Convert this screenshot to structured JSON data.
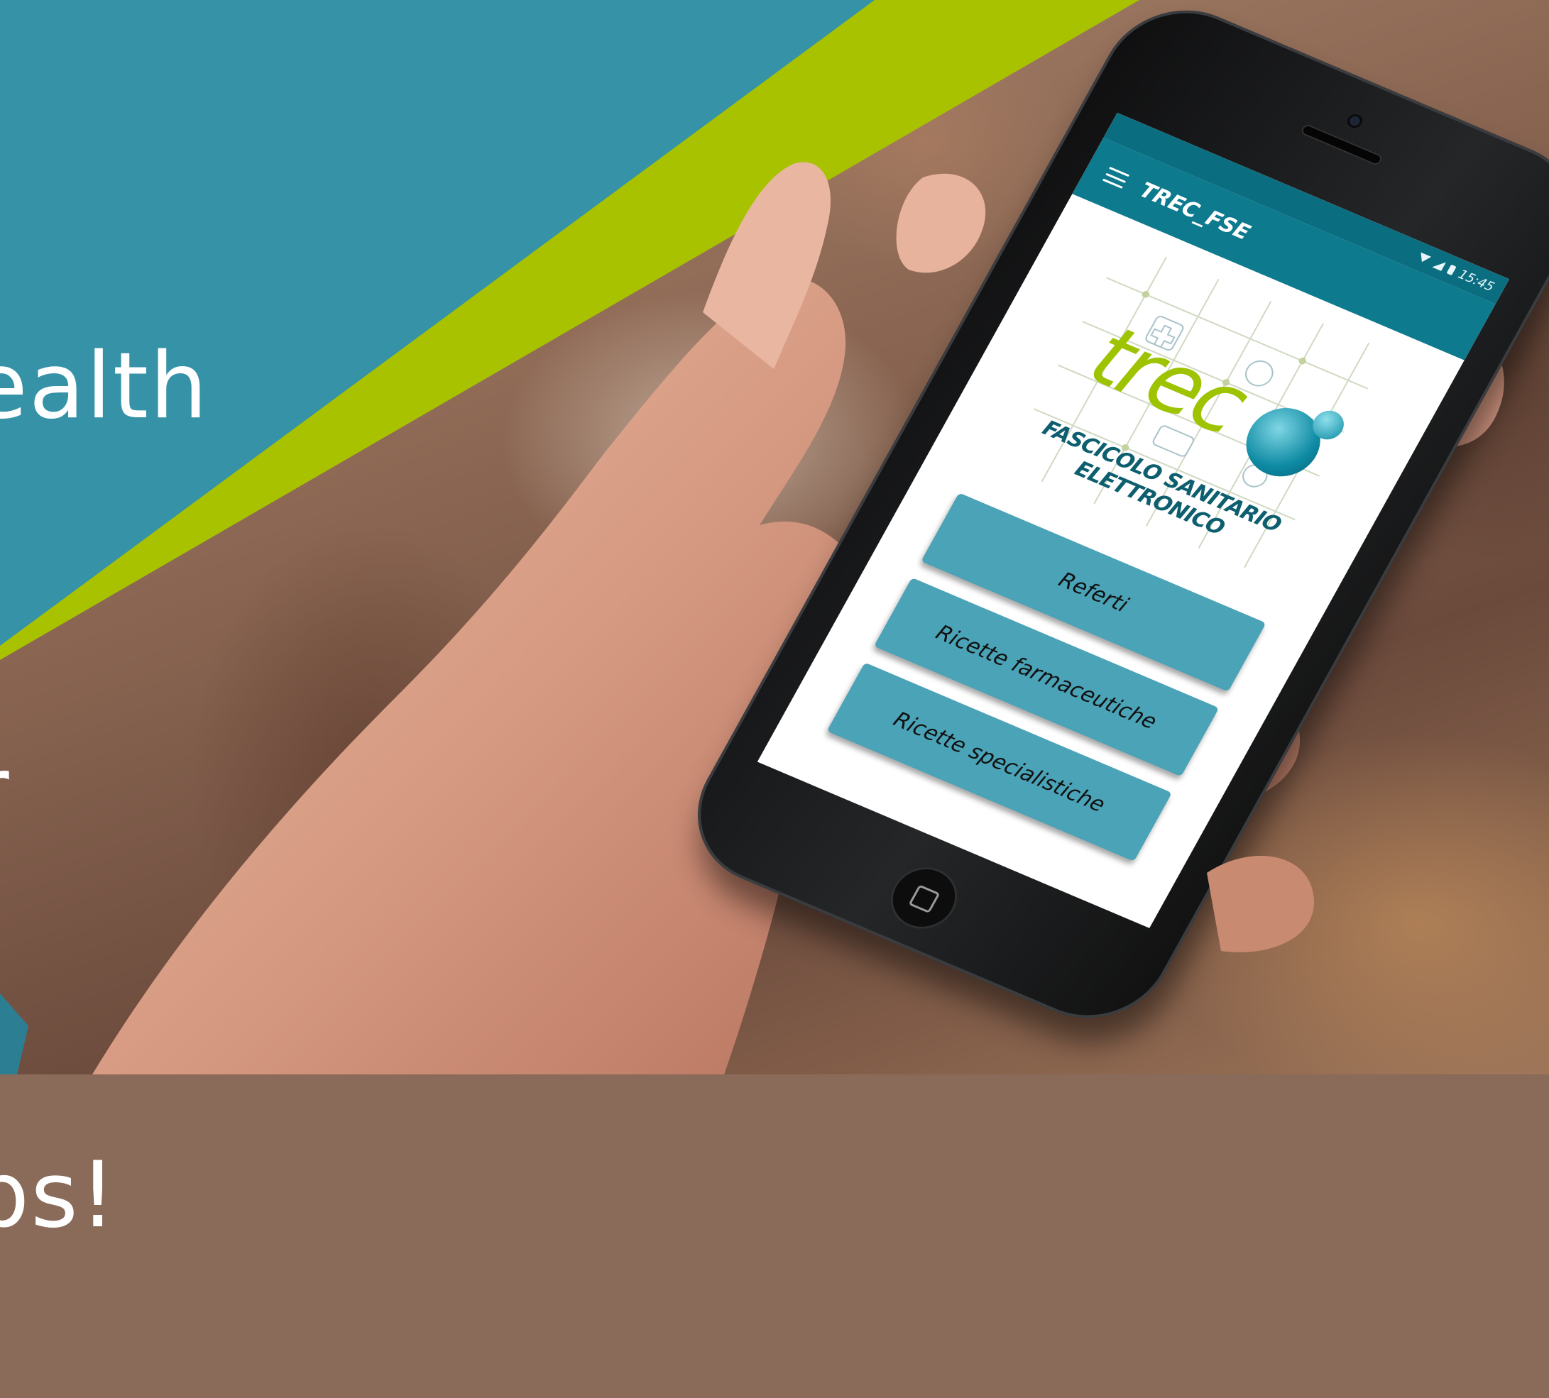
{
  "headline": {
    "lines": [
      "ealth",
      "r",
      "ps!"
    ]
  },
  "colors": {
    "banner_teal": "#3592a7",
    "banner_lime": "#a8c200",
    "app_bar": "#0e7a8e",
    "button": "#4aa3b7",
    "logo_green": "#9ec300"
  },
  "app": {
    "status": {
      "time": "15:45",
      "icons": [
        "wifi-icon",
        "signal-icon",
        "battery-icon"
      ]
    },
    "appbar": {
      "menu_icon": "menu-icon",
      "title": "TREC_FSE"
    },
    "logo": {
      "word": "trec",
      "subtitle": "FASCICOLO SANITARIO ELETTRONICO"
    },
    "buttons": [
      {
        "label": "Referti"
      },
      {
        "label": "Ricette farmaceutiche"
      },
      {
        "label": "Ricette specialistiche"
      }
    ]
  }
}
